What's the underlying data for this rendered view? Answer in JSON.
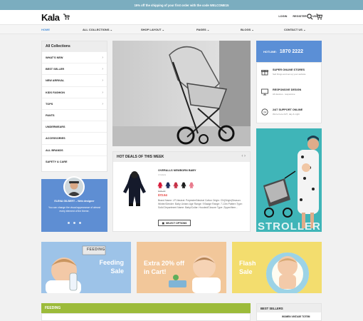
{
  "topbar": {
    "text": "15% off the shipping of your first order with the code WELCOME15"
  },
  "header": {
    "logo": "Kala",
    "links": [
      "LOGIN",
      "REGISTER",
      "USD $"
    ]
  },
  "nav": {
    "items": [
      {
        "label": "HOME",
        "active": true
      },
      {
        "label": "ALL COLLECTIONS",
        "chevron": "⌄"
      },
      {
        "label": "SHOP LAYOUT",
        "chevron": "⌄"
      },
      {
        "label": "PAGES",
        "chevron": "⌄"
      },
      {
        "label": "BLOGS",
        "chevron": "⌄"
      },
      {
        "label": "CONTACT US",
        "chevron": "⌄"
      }
    ]
  },
  "collections": {
    "title": "All Collections",
    "items": [
      {
        "label": "WHAT'S NEW",
        "has_children": true
      },
      {
        "label": "BEST SELLER",
        "has_children": true
      },
      {
        "label": "NEW ARRIVAL",
        "has_children": true
      },
      {
        "label": "KIDS FASHION",
        "has_children": true
      },
      {
        "label": "TOPS",
        "has_children": true
      },
      {
        "label": "PANTS",
        "has_children": false
      },
      {
        "label": "UNDERWEARS",
        "has_children": false
      },
      {
        "label": "ACCESSORIES",
        "has_children": false
      },
      {
        "label": "ALL BRANDS",
        "has_children": false
      },
      {
        "label": "SAFETY & CARE",
        "has_children": false
      }
    ]
  },
  "testimonial": {
    "name": "ELENA GILBERT – Web designer",
    "text": "You can change the visual appearance of almost every element of the theme.",
    "dots": 3
  },
  "deals": {
    "title": "HOT DEALS OF THIS WEEK",
    "product": {
      "name": "OVERALLS NEWBORN BABY",
      "colors_label": "4 Colors",
      "swatch_colors": [
        "#d81b3a",
        "#1b2a5a",
        "#c62f45",
        "#1c1c1c",
        "#e97b8d"
      ],
      "old_price": "$39.29",
      "price": "$72.54",
      "description": "Brand Name: LP-Neutral: Polyester/Neutral Cotton Origin: CN(Origin)Season: Winter/Gender: Baby Unisex Age Range: 9 Badge Range: 7-13m Pattern Type: Solid Department Name: Baby/Collar: Hooded/Closure Type: Zipper/Item...",
      "button": "SELECT OPTIONS"
    }
  },
  "hotline": {
    "label": "HOTLINE:",
    "number": "1870 2222"
  },
  "features": [
    {
      "icon": "gift-icon",
      "title": "SUPER ONLINE STORES",
      "sub": "Sell things and set up your website"
    },
    {
      "icon": "monitor-icon",
      "title": "RESPONSIVE DESIGN",
      "sub": "All devices - responsive"
    },
    {
      "icon": "support-24-icon",
      "title": "24/7 SUPPORT ONLINE",
      "sub": "We're here 24/7, day & night"
    }
  ],
  "stroller_banner": {
    "word": "STROLLER"
  },
  "banners": [
    {
      "label": "FEEDING",
      "title_lines": [
        "Feeding",
        "Sale"
      ]
    },
    {
      "title_lines": [
        "Extra 20% off",
        "in Cart!"
      ]
    },
    {
      "title_lines": [
        "Flash",
        "Sale"
      ]
    }
  ],
  "feeding_section": {
    "title": "FEEDING"
  },
  "best_sellers": {
    "title": "BEST SELLERS",
    "first_item": "WOMEN VINTAGE TOTEM"
  },
  "colors": {
    "accent": "#5b8fd6",
    "topbar": "#7badbf",
    "feeding": "#9cbb3a",
    "price": "#e53935"
  }
}
